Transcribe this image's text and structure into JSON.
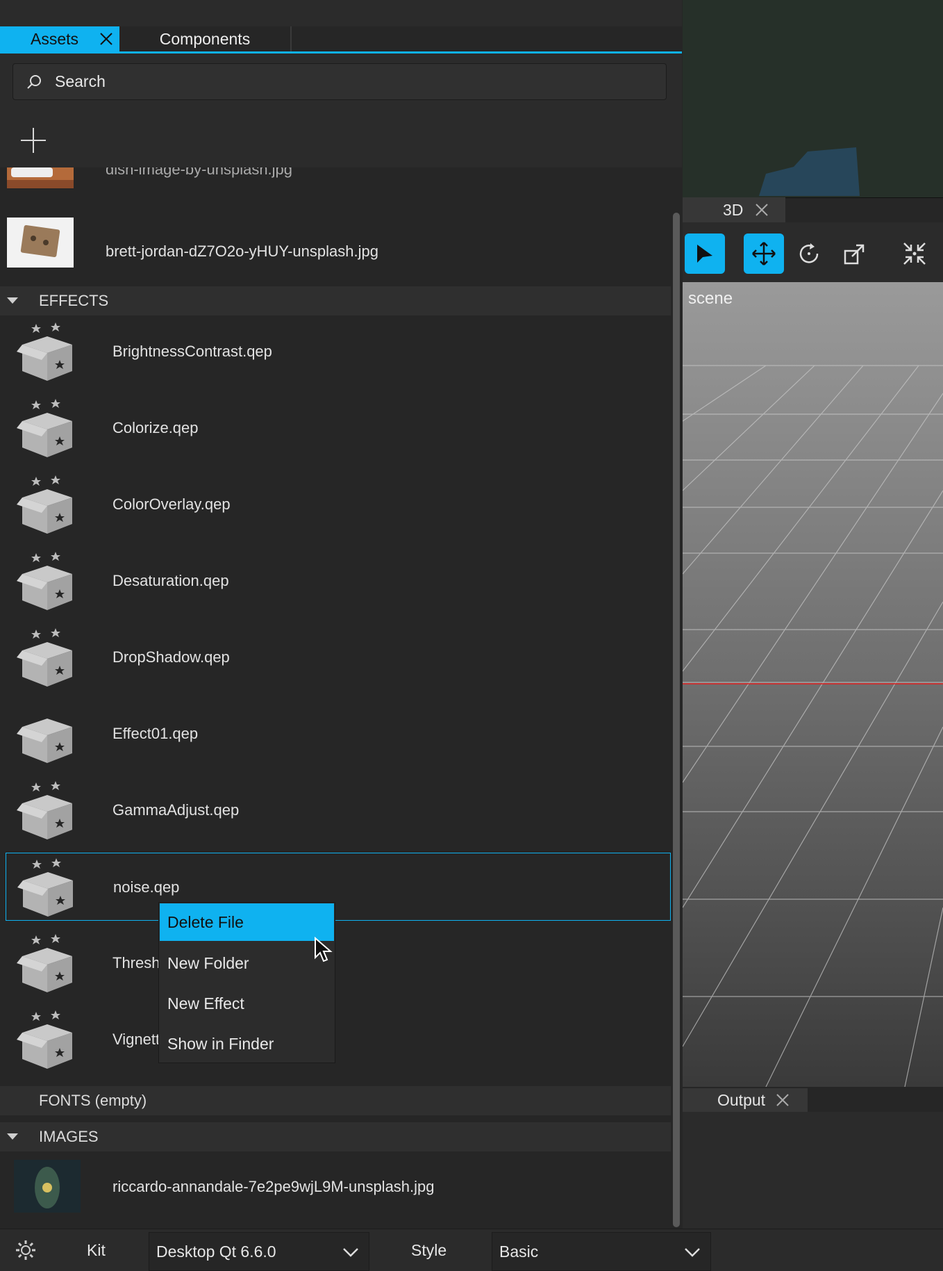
{
  "tabs": {
    "assets": "Assets",
    "components": "Components"
  },
  "search": {
    "placeholder": "Search"
  },
  "images_top": {
    "partial_name": "dish-image-by-unsplash.jpg",
    "brett": "brett-jordan-dZ7O2o-yHUY-unsplash.jpg"
  },
  "sections": {
    "effects": "EFFECTS",
    "fonts": "FONTS (empty)",
    "images": "IMAGES"
  },
  "effects": [
    "BrightnessContrast.qep",
    "Colorize.qep",
    "ColorOverlay.qep",
    "Desaturation.qep",
    "DropShadow.qep",
    "Effect01.qep",
    "GammaAdjust.qep",
    "noise.qep",
    "Threshold.qep",
    "Vignette.qep"
  ],
  "images": [
    "riccardo-annandale-7e2pe9wjL9M-unsplash.jpg"
  ],
  "context_menu": [
    "Delete File",
    "New Folder",
    "New Effect",
    "Show in Finder"
  ],
  "viewport": {
    "tab": "3D",
    "scene_label": "scene"
  },
  "output": {
    "tab": "Output"
  },
  "statusbar": {
    "kit_label": "Kit",
    "kit_value": "Desktop Qt 6.6.0",
    "style_label": "Style",
    "style_value": "Basic"
  },
  "colors": {
    "accent": "#0fb2f0",
    "panel": "#262626"
  }
}
